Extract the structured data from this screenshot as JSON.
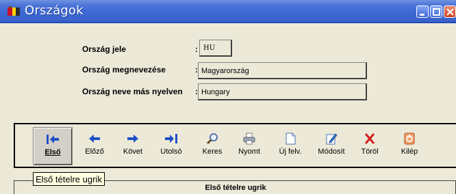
{
  "window": {
    "title": "Országok",
    "icon": "app-icon"
  },
  "form": {
    "country_code_label": "Ország jele",
    "country_code_value": "HU",
    "country_name_label": "Ország megnevezése",
    "country_name_value": "Magyarország",
    "country_other_label": "Ország neve más nyelven",
    "country_other_value": "Hungary",
    "colon": ":"
  },
  "toolbar": {
    "items": [
      {
        "label": "Első",
        "icon": "first-record-icon"
      },
      {
        "label": "Előző",
        "icon": "previous-record-icon"
      },
      {
        "label": "Követ",
        "icon": "next-record-icon"
      },
      {
        "label": "Utolsó",
        "icon": "last-record-icon"
      },
      {
        "label": "Keres",
        "icon": "search-icon"
      },
      {
        "label": "Nyomt",
        "icon": "print-icon"
      },
      {
        "label": "Új felv.",
        "icon": "new-record-icon"
      },
      {
        "label": "Módosít",
        "icon": "edit-icon"
      },
      {
        "label": "Töröl",
        "icon": "delete-icon"
      },
      {
        "label": "Kilép",
        "icon": "exit-icon"
      }
    ]
  },
  "tooltip": {
    "text": "Első tételre ugrik"
  },
  "status": {
    "text": "Első tételre ugrik"
  },
  "colors": {
    "title_blue": "#3b62c9",
    "arrow_blue": "#1f4fc8",
    "delete_red": "#d21e1e",
    "exit_orange": "#e06a2a",
    "window_bg": "#ece9d8",
    "tooltip_bg": "#ffffe1"
  }
}
